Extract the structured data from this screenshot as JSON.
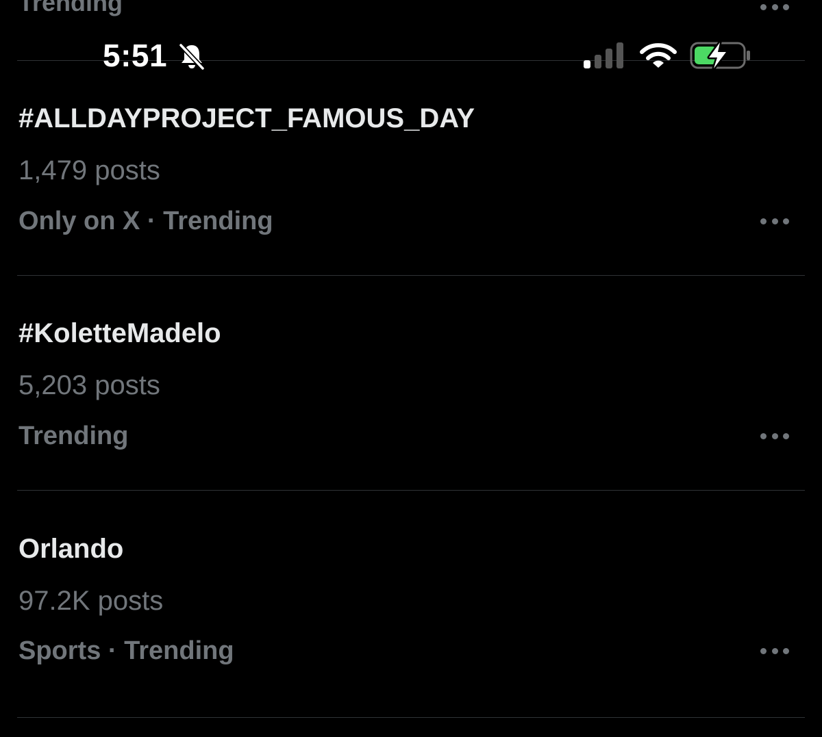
{
  "status_bar": {
    "time": "5:51",
    "icons": [
      "bell-slash-icon",
      "cellular-signal-icon",
      "wifi-icon",
      "battery-charging-icon"
    ],
    "battery_color": "#4cd964"
  },
  "previous_trend": {
    "category": "Trending"
  },
  "trends": [
    {
      "name": "#ALLDAYPROJECT_FAMOUS_DAY",
      "post_count": "1,479 posts",
      "category": "Only on X · Trending"
    },
    {
      "name": "#KoletteMadelo",
      "post_count": "5,203 posts",
      "category": "Trending"
    },
    {
      "name": "Orlando",
      "post_count": "97.2K posts",
      "category": "Sports · Trending"
    }
  ],
  "colors": {
    "background": "#000000",
    "primary_text": "#e7e9ea",
    "secondary_text": "#71767b",
    "divider": "#2f3336"
  }
}
